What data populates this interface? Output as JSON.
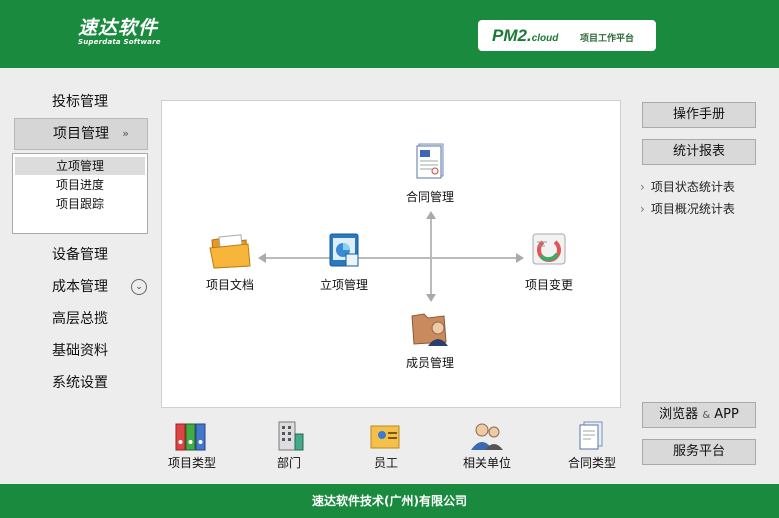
{
  "header": {
    "logo_cn": "速达软件",
    "logo_en": "Superdata Software",
    "product_main": "PM2.",
    "product_suffix": "cloud",
    "product_sub": "项目工作平台"
  },
  "menu": {
    "items": [
      {
        "label": "投标管理"
      },
      {
        "label": "项目管理"
      },
      {
        "label": "设备管理"
      },
      {
        "label": "成本管理"
      },
      {
        "label": "高层总揽"
      },
      {
        "label": "基础资料"
      },
      {
        "label": "系统设置"
      }
    ],
    "submenu": [
      {
        "label": "立项管理"
      },
      {
        "label": "项目进度"
      },
      {
        "label": "项目跟踪"
      }
    ]
  },
  "diagram": {
    "contract": "合同管理",
    "docs": "项目文档",
    "project": "立项管理",
    "change": "项目变更",
    "members": "成员管理"
  },
  "right": {
    "manual": "操作手册",
    "reports": "统计报表",
    "links": [
      {
        "label": "项目状态统计表"
      },
      {
        "label": "项目概况统计表"
      }
    ],
    "browser_app": "浏览器",
    "browser_amp": "&",
    "browser_app2": "APP",
    "service": "服务平台"
  },
  "bottom": {
    "items": [
      {
        "label": "项目类型"
      },
      {
        "label": "部门"
      },
      {
        "label": "员工"
      },
      {
        "label": "相关单位"
      },
      {
        "label": "合同类型"
      }
    ]
  },
  "footer": {
    "text": "速达软件技术(广州)有限公司"
  },
  "colors": {
    "brand_green": "#1a8a3e"
  }
}
